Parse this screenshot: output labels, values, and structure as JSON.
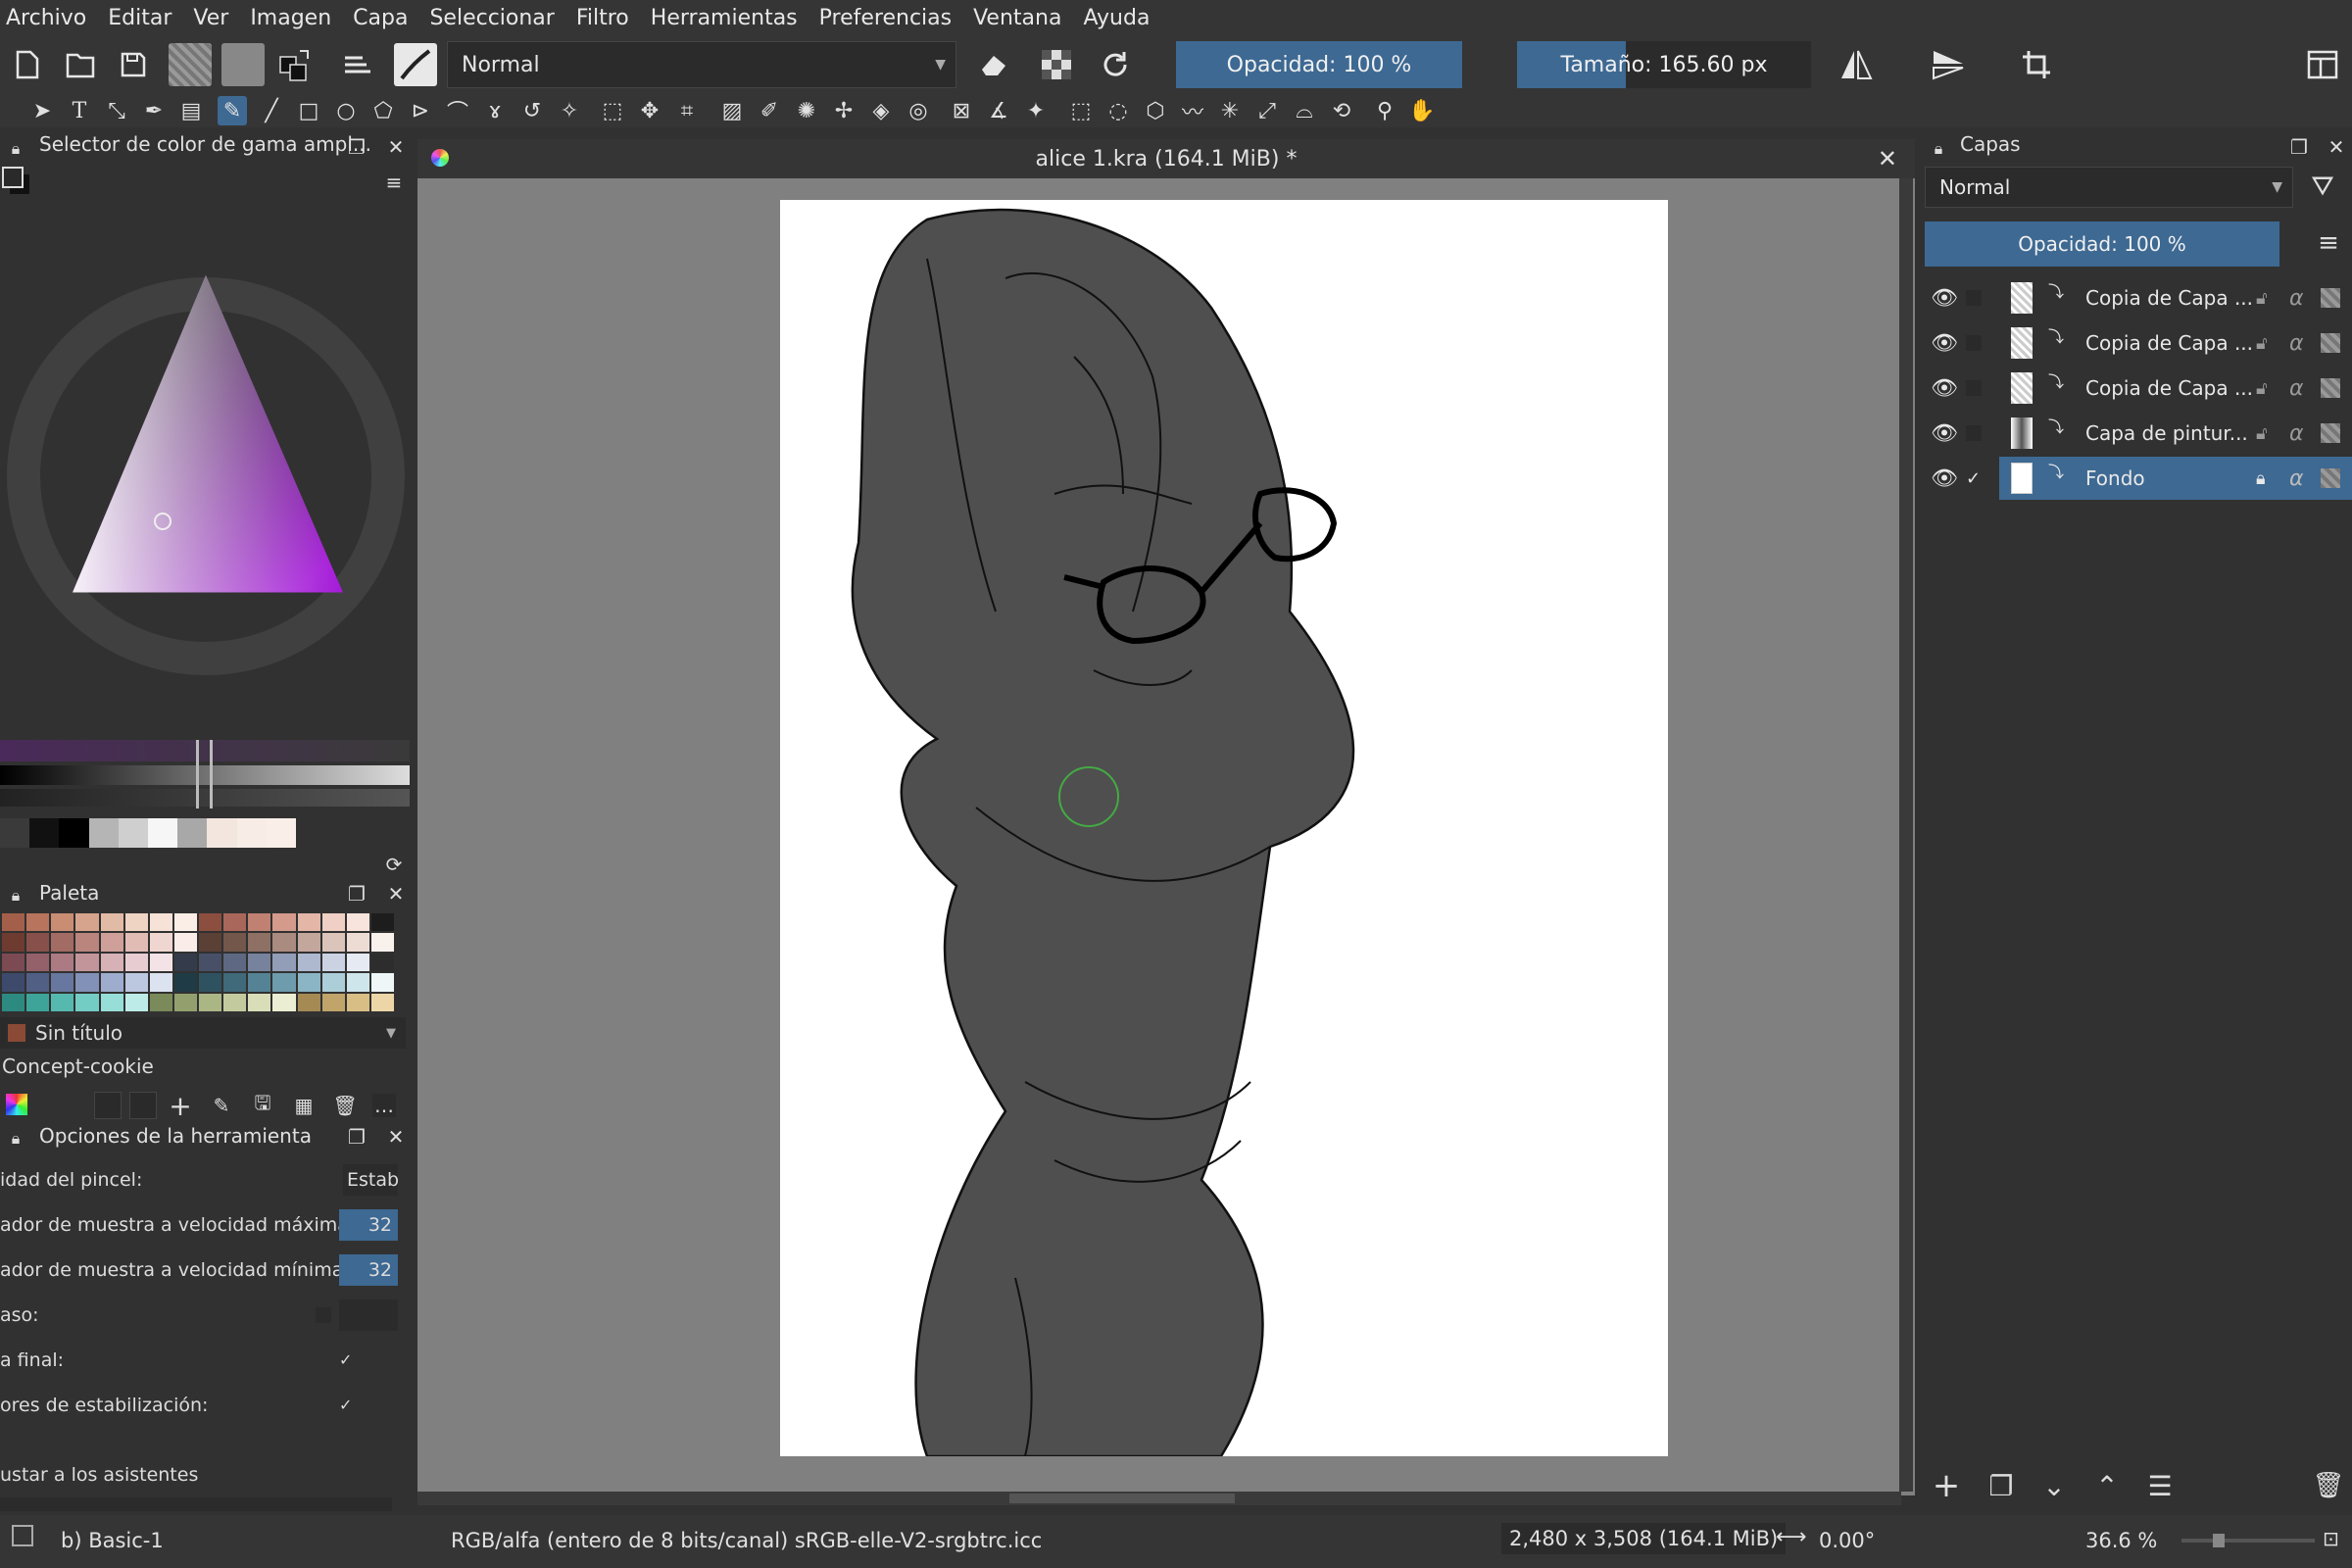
{
  "menu": [
    "Archivo",
    "Editar",
    "Ver",
    "Imagen",
    "Capa",
    "Seleccionar",
    "Filtro",
    "Herramientas",
    "Preferencias",
    "Ventana",
    "Ayuda"
  ],
  "toolbar": {
    "blend_mode": "Normal",
    "opacity_label": "Opacidad: 100 %",
    "size_label": "Tamaño: 165.60 px"
  },
  "left_dock": {
    "color_selector_title": "Selector de color de gama ampl...",
    "palette_title": "Paleta",
    "palette_name": "Sin título",
    "palette_set": "Concept-cookie",
    "tool_options_title": "Opciones de la herramienta",
    "options": [
      {
        "label": "idad del pincel:",
        "value": "Estab"
      },
      {
        "label": "ador de muestra a velocidad máxima:",
        "value": "32"
      },
      {
        "label": "ador de muestra a velocidad mínima:",
        "value": "32"
      },
      {
        "label": "aso:",
        "value": ""
      },
      {
        "label": "a final:",
        "value": "✓"
      },
      {
        "label": "ores de estabilización:",
        "value": "✓"
      }
    ],
    "assistants_label": "ustar a los asistentes",
    "palette_colors": [
      "#a35f4a",
      "#b8745c",
      "#c98d74",
      "#d6a48c",
      "#e2bba6",
      "#efd3c3",
      "#f6e2d6",
      "#faeee6",
      "#8c4e3e",
      "#a9665a",
      "#c08172",
      "#d49b8c",
      "#e3b6a8",
      "#f0d0c4",
      "#f8e4dc",
      "#1d1d1d",
      "#6e3b31",
      "#88504a",
      "#a26b63",
      "#b9857d",
      "#cfa099",
      "#e1bcb5",
      "#f0d6d1",
      "#f9ece9",
      "#5b4036",
      "#74574b",
      "#8e7064",
      "#a98b7f",
      "#c3a79c",
      "#dbc4ba",
      "#eddcd4",
      "#f9f1ec",
      "#7b4a53",
      "#946069",
      "#ac7a82",
      "#c2959b",
      "#d6b1b6",
      "#e7cdd1",
      "#f4e3e6",
      "#343b4a",
      "#475066",
      "#5e6882",
      "#77829d",
      "#929db7",
      "#aeb8cf",
      "#cbd3e3",
      "#e6ebf3",
      "#2d2d2d",
      "#3d4a6b",
      "#515f85",
      "#68779f",
      "#8291b7",
      "#9eadcd",
      "#bcc8e0",
      "#dbe3f0",
      "#1f3b45",
      "#2e5260",
      "#406a7a",
      "#558395",
      "#6e9cad",
      "#8bb5c4",
      "#acced9",
      "#cfe5ec",
      "#eef6f8",
      "#2c8a80",
      "#3ea399",
      "#56b9b0",
      "#74cdc5",
      "#97ded8",
      "#bdece8",
      "#7a8a5a",
      "#93a06e",
      "#abb685",
      "#c3cb9e",
      "#d9deb8",
      "#ebeed3",
      "#a58a54",
      "#c0a46a",
      "#d8bd85",
      "#ecd6a8"
    ],
    "gradient_swatches": [
      "#3a3a3a",
      "#111111",
      "#000000",
      "#b5b5b5",
      "#cfcfcf",
      "#f6f6f6",
      "#a8a8a8",
      "#f3e6df",
      "#f7ece6",
      "#f9efe8"
    ]
  },
  "document": {
    "tab_title": "alice 1.kra (164.1 MiB) *"
  },
  "layers_panel": {
    "title": "Capas",
    "blend_mode": "Normal",
    "opacity_label": "Opacidad: 100 %",
    "layers": [
      {
        "name": "Copia de Capa ...",
        "selected": false,
        "checked": false,
        "locked": false
      },
      {
        "name": "Copia de Capa ...",
        "selected": false,
        "checked": false,
        "locked": false
      },
      {
        "name": "Copia de Capa ...",
        "selected": false,
        "checked": false,
        "locked": false
      },
      {
        "name": "Capa de pintur...",
        "selected": false,
        "checked": false,
        "locked": false
      },
      {
        "name": "Fondo",
        "selected": true,
        "checked": true,
        "locked": true
      }
    ]
  },
  "status": {
    "brush": "b) Basic-1",
    "color_space": "RGB/alfa (entero de 8 bits/canal)  sRGB-elle-V2-srgbtrc.icc",
    "dimensions": "2,480 x 3,508 (164.1 MiB)",
    "rotation": "0.00°",
    "zoom": "36.6 %"
  }
}
